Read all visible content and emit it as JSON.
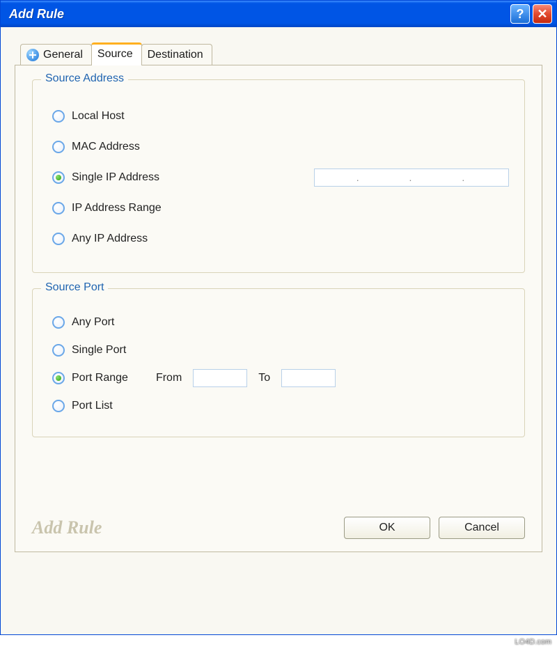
{
  "title": "Add Rule",
  "tabs": [
    {
      "label": "General"
    },
    {
      "label": "Source"
    },
    {
      "label": "Destination"
    }
  ],
  "active_tab": 1,
  "group_address": {
    "legend": "Source Address",
    "options": {
      "local_host": "Local Host",
      "mac": "MAC Address",
      "single_ip": "Single IP Address",
      "ip_range": "IP Address Range",
      "any_ip": "Any IP Address"
    },
    "selected": "single_ip",
    "ip_value": ".          .          ."
  },
  "group_port": {
    "legend": "Source Port",
    "options": {
      "any_port": "Any Port",
      "single_port": "Single Port",
      "port_range": "Port Range",
      "port_list": "Port List"
    },
    "selected": "port_range",
    "from_label": "From",
    "to_label": "To",
    "from_value": "",
    "to_value": ""
  },
  "footer": {
    "watermark": "Add Rule",
    "ok": "OK",
    "cancel": "Cancel"
  },
  "page_watermark": "LO4D.com"
}
